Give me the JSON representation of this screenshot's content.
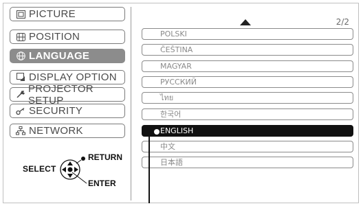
{
  "menu": {
    "items": [
      {
        "label": "PICTURE",
        "icon": "picture-icon"
      },
      {
        "label": "POSITION",
        "icon": "position-icon"
      },
      {
        "label": "LANGUAGE",
        "icon": "globe-icon",
        "active": true
      },
      {
        "label": "DISPLAY OPTION",
        "icon": "display-option-icon"
      },
      {
        "label": "PROJECTOR SETUP",
        "icon": "wrench-icon"
      },
      {
        "label": "SECURITY",
        "icon": "key-icon"
      },
      {
        "label": "NETWORK",
        "icon": "network-icon"
      }
    ]
  },
  "languages": {
    "page_indicator": "2/2",
    "items": [
      "POLSKI",
      "ČEŠTINA",
      "MAGYAR",
      "РУССКИЙ",
      "ไทย",
      "한국어",
      "ENGLISH",
      "中文",
      "日本語"
    ],
    "selected": "ENGLISH"
  },
  "controls": {
    "select_label": "SELECT",
    "return_label": "RETURN",
    "enter_label": "ENTER"
  },
  "colors": {
    "active_menu_bg": "#8c8c8c",
    "selected_item_bg": "#111111",
    "border": "#8a8a8a"
  }
}
